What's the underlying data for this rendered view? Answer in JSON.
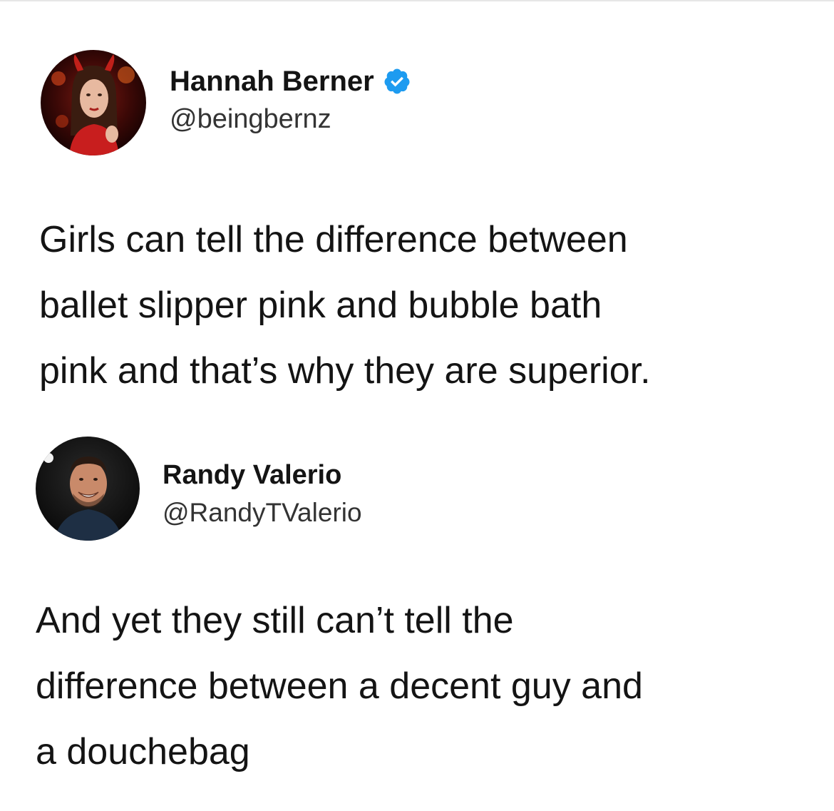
{
  "tweets": [
    {
      "display_name": "Hannah Berner",
      "handle": "@beingbernz",
      "verified": true,
      "avatar_icon": "profile-photo",
      "text": "Girls can tell the difference between\nballet slipper pink and bubble bath\npink and that’s why they are superior."
    },
    {
      "display_name": "Randy Valerio",
      "handle": "@RandyTValerio",
      "verified": false,
      "avatar_icon": "profile-photo",
      "text": "And yet they still can’t tell the\ndifference between a decent guy and\na douchebag"
    }
  ],
  "colors": {
    "verified_badge": "#1d9bf0",
    "text": "#141414",
    "handle": "#333333"
  }
}
